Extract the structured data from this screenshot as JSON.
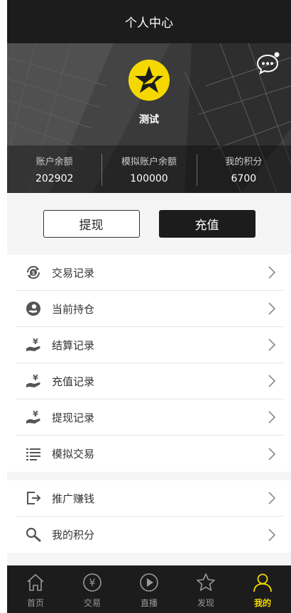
{
  "header": {
    "title": "个人中心"
  },
  "profile": {
    "username": "测试",
    "stats": [
      {
        "label": "账户余额",
        "value": "202902"
      },
      {
        "label": "模拟账户余额",
        "value": "100000"
      },
      {
        "label": "我的积分",
        "value": "6700"
      }
    ]
  },
  "actions": {
    "withdraw_label": "提现",
    "recharge_label": "充值"
  },
  "menu": {
    "group1": [
      {
        "label": "交易记录",
        "icon": "exchange-dollar-icon"
      },
      {
        "label": "当前持仓",
        "icon": "holding-icon"
      },
      {
        "label": "结算记录",
        "icon": "settlement-icon"
      },
      {
        "label": "充值记录",
        "icon": "recharge-record-icon"
      },
      {
        "label": "提现记录",
        "icon": "withdraw-record-icon"
      },
      {
        "label": "模拟交易",
        "icon": "list-icon"
      }
    ],
    "group2": [
      {
        "label": "推广赚钱",
        "icon": "share-exit-icon"
      },
      {
        "label": "我的积分",
        "icon": "search-icon"
      }
    ]
  },
  "tabbar": {
    "items": [
      {
        "label": "首页",
        "icon": "home-icon"
      },
      {
        "label": "交易",
        "icon": "yen-circle-icon"
      },
      {
        "label": "直播",
        "icon": "play-circle-icon"
      },
      {
        "label": "发现",
        "icon": "star-icon"
      },
      {
        "label": "我的",
        "icon": "user-icon"
      }
    ],
    "active_index": 4
  },
  "colors": {
    "accent": "#f5d800",
    "dark": "#1c1c1c"
  }
}
